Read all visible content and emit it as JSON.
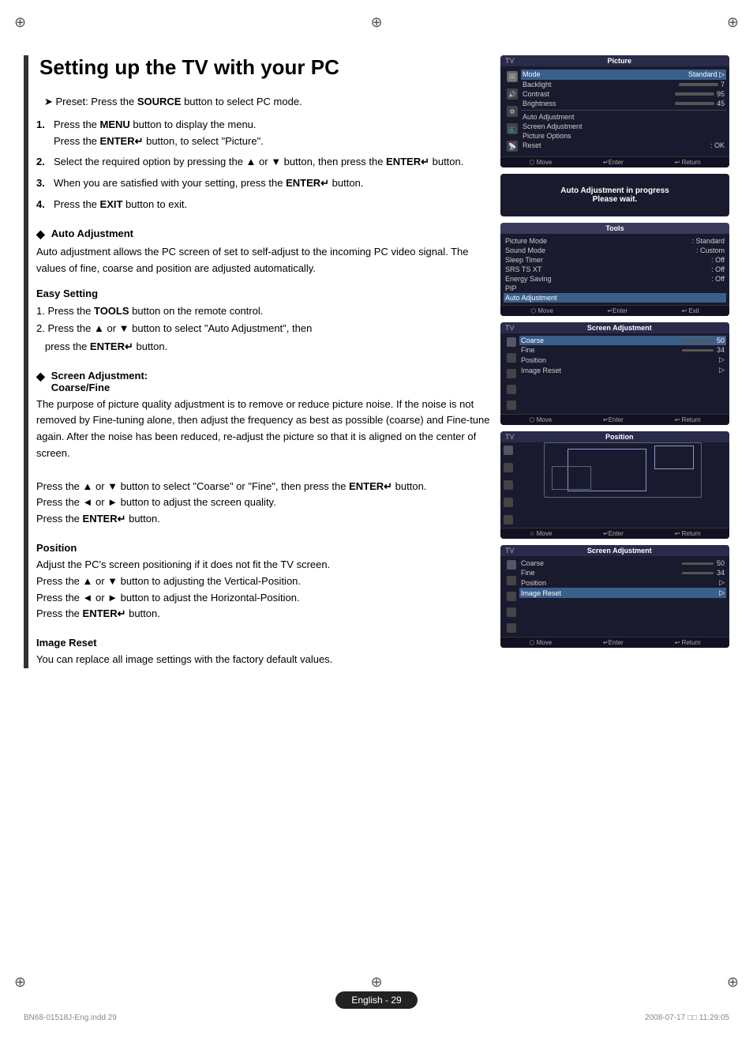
{
  "page": {
    "title": "Setting up the TV with your PC",
    "crosshair_symbol": "⊕"
  },
  "instructions": {
    "preset": "Preset: Press the SOURCE button to select PC mode.",
    "steps": [
      {
        "num": "1.",
        "text": "Press the MENU button to display the menu.\nPress the ENTER↵ button, to select \"Picture\"."
      },
      {
        "num": "2.",
        "text": "Select the required option by pressing the ▲ or ▼ button,\nthen press the ENTER↵ button."
      },
      {
        "num": "3.",
        "text": "When you are satisfied with your setting, press the\nENTER↵ button."
      },
      {
        "num": "4.",
        "text": "Press the EXIT button to exit."
      }
    ]
  },
  "auto_adjustment": {
    "title": "Auto Adjustment",
    "body": "Auto adjustment allows the PC screen of set to self-adjust to the incoming PC video signal. The values of fine, coarse and position are adjusted automatically.",
    "easy_setting_title": "Easy Setting",
    "easy_steps": [
      "1. Press the TOOLS button on the remote control.",
      "2. Press the ▲ or ▼ button to select \"Auto Adjustment\", then\n   press the ENTER↵ button."
    ]
  },
  "screen_adjustment": {
    "title": "Screen Adjustment:",
    "subtitle": "Coarse/Fine",
    "body": "The purpose of picture quality adjustment is to remove or reduce picture noise. If the noise is not removed by Fine-tuning alone, then adjust the frequency as best as possible (coarse) and Fine-tune again. After the noise has been reduced, re-adjust the picture so that it is aligned on the center of screen.",
    "steps": [
      "Press the ▲ or ▼ button to select \"Coarse\" or \"Fine\", then press the ENTER↵ button.",
      "Press the ◄ or ► button to adjust the screen quality.",
      "Press the ENTER↵ button."
    ],
    "position_title": "Position",
    "position_body": "Adjust the PC's screen positioning if it does not fit the TV screen.",
    "position_steps": [
      "Press the ▲ or ▼ button to adjusting the Vertical-Position.",
      "Press the ◄ or ► button to adjust the Horizontal-Position.",
      "Press the ENTER↵ button."
    ],
    "image_reset_title": "Image Reset",
    "image_reset_body": "You can replace all image settings with the factory default values."
  },
  "tv_panel_picture": {
    "tv_label": "TV",
    "panel_title": "Picture",
    "items": [
      {
        "label": "Mode",
        "value": "Standard",
        "selected": false
      },
      {
        "label": "Backlight",
        "bar": true,
        "bar_pct": 15,
        "value": "7",
        "selected": false
      },
      {
        "label": "Contrast",
        "bar": true,
        "bar_pct": 95,
        "value": "95",
        "selected": false
      },
      {
        "label": "Brightness",
        "bar": true,
        "bar_pct": 45,
        "value": "45",
        "selected": false
      },
      {
        "label": "Auto Adjustment",
        "value": "",
        "selected": false
      },
      {
        "label": "Screen Adjustment",
        "value": "",
        "selected": false
      },
      {
        "label": "Picture Options",
        "value": "",
        "selected": false
      },
      {
        "label": "Reset",
        "value": ": OK",
        "selected": false
      }
    ],
    "footer": [
      "⬡ Move",
      "↵Enter",
      "↩ Return"
    ]
  },
  "auto_adj_dialog": {
    "line1": "Auto Adjustment in progress",
    "line2": "Please wait."
  },
  "tools_panel": {
    "title": "Tools",
    "items": [
      {
        "label": "Picture Mode",
        "value": ": Standard"
      },
      {
        "label": "Sound Mode",
        "value": ": Custom"
      },
      {
        "label": "Sleep Timer",
        "value": ": Off"
      },
      {
        "label": "SRS TS XT",
        "value": ": Off"
      },
      {
        "label": "Energy Saving",
        "value": ": Off"
      },
      {
        "label": "PIP",
        "value": ""
      },
      {
        "label": "Auto Adjustment",
        "value": "",
        "highlighted": true
      }
    ],
    "footer": [
      "⬡ Move",
      "↵Enter",
      "↩ Exit"
    ]
  },
  "screen_adj_panel1": {
    "tv_label": "TV",
    "panel_title": "Screen Adjustment",
    "items": [
      {
        "label": "Coarse",
        "bar": true,
        "bar_pct": 78,
        "value": "50",
        "selected": true
      },
      {
        "label": "Fine",
        "bar": true,
        "bar_pct": 65,
        "value": "34",
        "selected": false
      },
      {
        "label": "Position",
        "value": ">",
        "selected": false
      },
      {
        "label": "Image Reset",
        "value": ">",
        "selected": false
      }
    ],
    "footer": [
      "⬡ Move",
      "↵Enter",
      "↩ Return"
    ]
  },
  "position_panel": {
    "tv_label": "TV",
    "panel_title": "Position",
    "footer": [
      "☆ Move",
      "↵Enter",
      "↩ Return"
    ]
  },
  "screen_adj_panel2": {
    "tv_label": "TV",
    "panel_title": "Screen Adjustment",
    "items": [
      {
        "label": "Coarse",
        "bar": true,
        "bar_pct": 78,
        "value": "50",
        "selected": false
      },
      {
        "label": "Fine",
        "bar": true,
        "bar_pct": 65,
        "value": "34",
        "selected": false
      },
      {
        "label": "Position",
        "value": ">",
        "selected": false
      },
      {
        "label": "Image Reset",
        "value": ">",
        "selected": true
      }
    ],
    "footer": [
      "⬡ Move",
      "↵Enter",
      "↩ Return"
    ]
  },
  "footer": {
    "page_label": "English - 29",
    "file_info": "BN68-01518J-Eng.indd   29",
    "date_info": "2008-07-17   □□ 11:29:05"
  }
}
